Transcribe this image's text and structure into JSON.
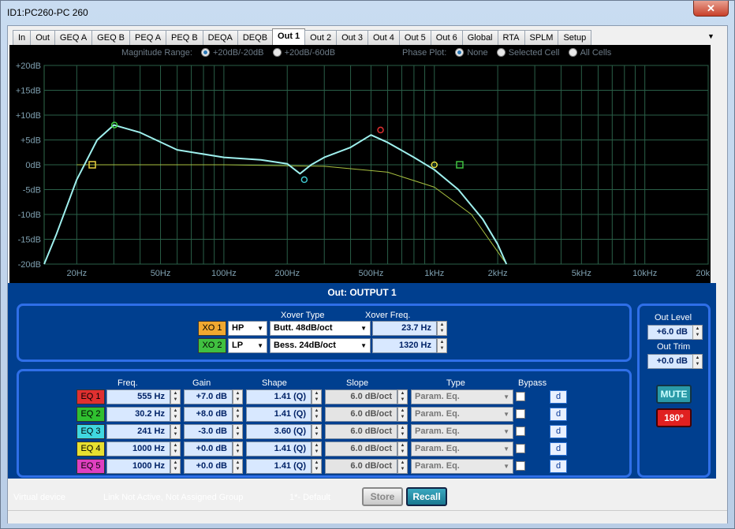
{
  "window": {
    "title": "ID1:PC260-PC 260",
    "close": "✕"
  },
  "tabs": [
    "In",
    "Out",
    "GEQ A",
    "GEQ B",
    "PEQ A",
    "PEQ B",
    "DEQA",
    "DEQB",
    "Out 1",
    "Out 2",
    "Out 3",
    "Out 4",
    "Out 5",
    "Out 6",
    "Global",
    "RTA",
    "SPLM",
    "Setup"
  ],
  "active_tab": "Out 1",
  "graph": {
    "magnitude_label": "Magnitude Range:",
    "mag_opt1": "+20dB/-20dB",
    "mag_opt2": "+20dB/-60dB",
    "phase_label": "Phase Plot:",
    "phase_opt1": "None",
    "phase_opt2": "Selected Cell",
    "phase_opt3": "All Cells",
    "y_ticks": [
      "+20dB",
      "+15dB",
      "+10dB",
      "+5dB",
      "0dB",
      "-5dB",
      "-10dB",
      "-15dB",
      "-20dB"
    ],
    "x_ticks": [
      "20Hz",
      "50Hz",
      "100Hz",
      "200Hz",
      "500Hz",
      "1kHz",
      "2kHz",
      "5kHz",
      "10kHz",
      "20kHz"
    ]
  },
  "chart_data": {
    "type": "line",
    "xlabel": "",
    "ylabel": "",
    "xscale": "log",
    "xlim": [
      14,
      20000
    ],
    "ylim": [
      -20,
      20
    ],
    "series": [
      {
        "color": "#9ff0ee",
        "x": [
          14,
          16,
          20,
          25,
          30,
          40,
          60,
          100,
          150,
          200,
          230,
          260,
          300,
          400,
          500,
          600,
          800,
          1000,
          1300,
          1700,
          2000,
          2200
        ],
        "y": [
          -20,
          -14,
          -3,
          5,
          8,
          6.5,
          3,
          1.5,
          1,
          0.2,
          -1.8,
          0,
          1.5,
          3.5,
          6,
          4.5,
          1.5,
          -1,
          -5,
          -11,
          -16,
          -20
        ]
      },
      {
        "color": "#a8c040",
        "x": [
          20,
          100,
          300,
          600,
          1000,
          1500,
          2200
        ],
        "y": [
          0,
          0,
          -0.3,
          -1.5,
          -4.5,
          -10,
          -20
        ]
      }
    ],
    "markers": [
      {
        "x": 23.7,
        "y": 0,
        "color": "#e8d040",
        "shape": "square"
      },
      {
        "x": 30.2,
        "y": 8,
        "color": "#40d040",
        "shape": "circle"
      },
      {
        "x": 241,
        "y": -3,
        "color": "#40c8d0",
        "shape": "circle"
      },
      {
        "x": 555,
        "y": 7,
        "color": "#e03030",
        "shape": "circle"
      },
      {
        "x": 1000,
        "y": 0,
        "color": "#e8e040",
        "shape": "circle"
      },
      {
        "x": 1320,
        "y": 0,
        "color": "#40c040",
        "shape": "square"
      }
    ]
  },
  "output": {
    "title": "Out: OUTPUT 1"
  },
  "xover": {
    "type_header": "Xover Type",
    "freq_header": "Xover Freq.",
    "rows": [
      {
        "tag": "XO 1",
        "filter": "HP",
        "type": "Butt. 48dB/oct",
        "freq": "23.7 Hz",
        "color": "#f0a830"
      },
      {
        "tag": "XO 2",
        "filter": "LP",
        "type": "Bess. 24dB/oct",
        "freq": "1320 Hz",
        "color": "#40c040"
      }
    ]
  },
  "eq": {
    "headers": {
      "freq": "Freq.",
      "gain": "Gain",
      "shape": "Shape",
      "slope": "Slope",
      "type": "Type",
      "bypass": "Bypass"
    },
    "rows": [
      {
        "tag": "EQ 1",
        "freq": "555 Hz",
        "gain": "+7.0 dB",
        "shape": "1.41 (Q)",
        "slope": "6.0 dB/oct",
        "type": "Param. Eq.",
        "d": "d",
        "color": "#e03030"
      },
      {
        "tag": "EQ 2",
        "freq": "30.2 Hz",
        "gain": "+8.0 dB",
        "shape": "1.41 (Q)",
        "slope": "6.0 dB/oct",
        "type": "Param. Eq.",
        "d": "d",
        "color": "#30c030"
      },
      {
        "tag": "EQ 3",
        "freq": "241 Hz",
        "gain": "-3.0 dB",
        "shape": "3.60 (Q)",
        "slope": "6.0 dB/oct",
        "type": "Param. Eq.",
        "d": "d",
        "color": "#40d8e0"
      },
      {
        "tag": "EQ 4",
        "freq": "1000 Hz",
        "gain": "+0.0 dB",
        "shape": "1.41 (Q)",
        "slope": "6.0 dB/oct",
        "type": "Param. Eq.",
        "d": "d",
        "color": "#e8e030"
      },
      {
        "tag": "EQ 5",
        "freq": "1000 Hz",
        "gain": "+0.0 dB",
        "shape": "1.41 (Q)",
        "slope": "6.0 dB/oct",
        "type": "Param. Eq.",
        "d": "d",
        "color": "#e040c0"
      }
    ]
  },
  "levels": {
    "out_level_label": "Out Level",
    "out_level": "+6.0 dB",
    "out_trim_label": "Out Trim",
    "out_trim": "+0.0 dB",
    "mute": "MUTE",
    "phase": "180°"
  },
  "status": {
    "device": "Virtual device",
    "link": "Link Not Active,  Not Assigned Group",
    "preset": "1*- Default",
    "store": "Store",
    "recall": "Recall"
  }
}
